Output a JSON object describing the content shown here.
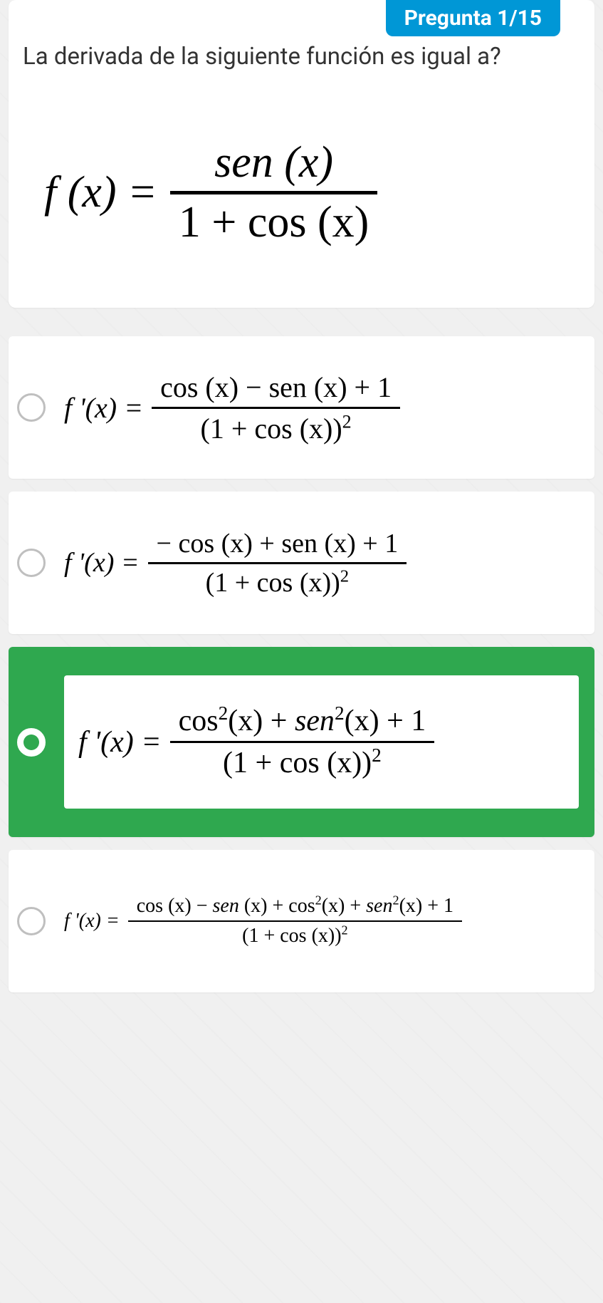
{
  "badge": "Pregunta 1/15",
  "question": "La derivada de la siguiente función es igual a?",
  "main": {
    "lhs": "f (x) =",
    "num": "sen (x)",
    "den": "1 + cos (x)"
  },
  "options": [
    {
      "selected": false,
      "size": "sz1",
      "lhs": "f '(x) =",
      "num": "cos (x) − sen (x) + 1",
      "den_html": "(1 + cos (x))<sup>2</sup>"
    },
    {
      "selected": false,
      "size": "sz2",
      "lhs": "f '(x) =",
      "num": "− cos (x) + sen (x) + 1",
      "den_html": "(1 + cos (x))<sup>2</sup>"
    },
    {
      "selected": true,
      "size": "sz3",
      "lhs": "f '(x) =",
      "num_html": "cos<sup>2</sup>(x) + <span class=\"it\">sen</span><sup>2</sup>(x) + 1",
      "den_html": "(1 + cos (x))<sup>2</sup>"
    },
    {
      "selected": false,
      "size": "sz4",
      "lhs": "f '(x) =",
      "num_html": "cos (x) − <span class=\"it\">sen</span> (x) + cos<sup>2</sup>(x) + <span class=\"it\">sen</span><sup>2</sup>(x) + 1",
      "den_html": "(1 + cos (x))<sup>2</sup>"
    }
  ]
}
